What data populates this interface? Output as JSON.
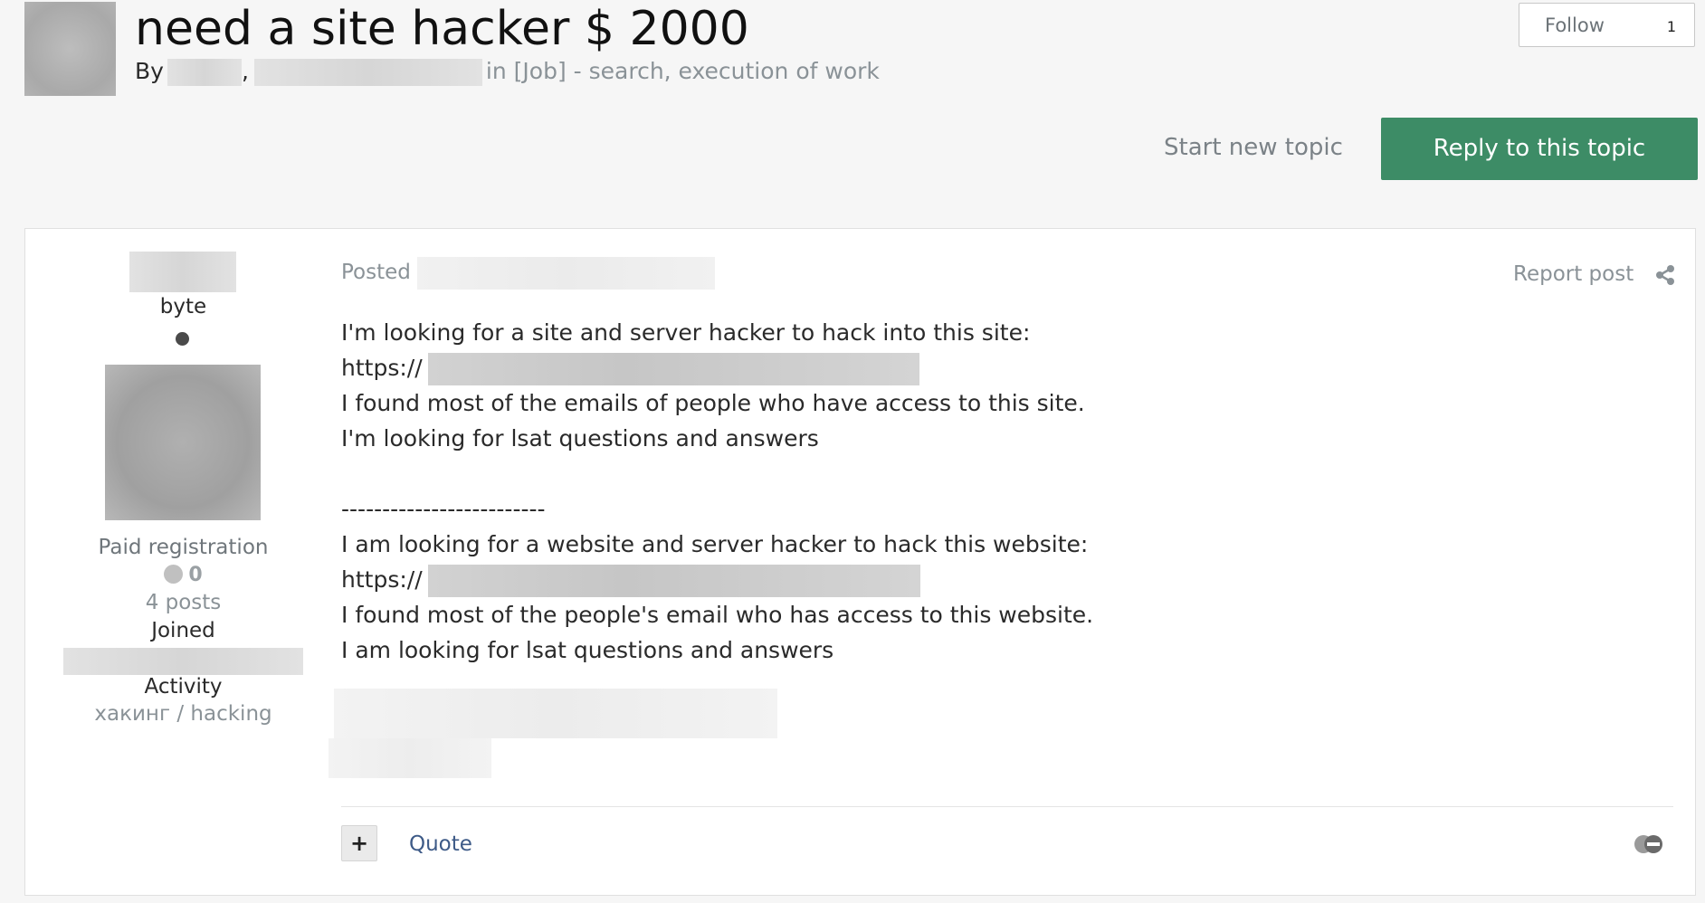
{
  "topic": {
    "title": "need a site hacker $ 2000",
    "by_label": "By",
    "comma": ",",
    "in_label": "in",
    "forum": "[Job] - search, execution of work"
  },
  "follow": {
    "label": "Follow",
    "count": "1"
  },
  "actions": {
    "start_topic": "Start new topic",
    "reply": "Reply to this topic"
  },
  "author": {
    "name": "byte",
    "group": "Paid registration",
    "reputation": "0",
    "posts": "4 posts",
    "joined_label": "Joined",
    "activity_label": "Activity",
    "activity_value": "хакинг / hacking"
  },
  "post": {
    "posted_label": "Posted",
    "report_label": "Report post",
    "lines": [
      "I'm looking for a site and server hacker to hack into this site:",
      "https://",
      "I found most of the emails of people who have access to this site.",
      "I'm looking for lsat questions and answers",
      "-------------------------",
      "I am looking for a website and server hacker to hack this website:",
      "https://",
      "I found most of the people's email who has access to this website.",
      "I am looking for lsat questions and answers"
    ]
  },
  "footer": {
    "plus": "+",
    "quote": "Quote"
  },
  "icons": {
    "share": "share-icon",
    "reaction": "reaction-icon",
    "online": "online-indicator"
  },
  "colors": {
    "accent_green": "#3d8c66",
    "link_blue": "#3d5a87",
    "muted": "#8a9297"
  }
}
